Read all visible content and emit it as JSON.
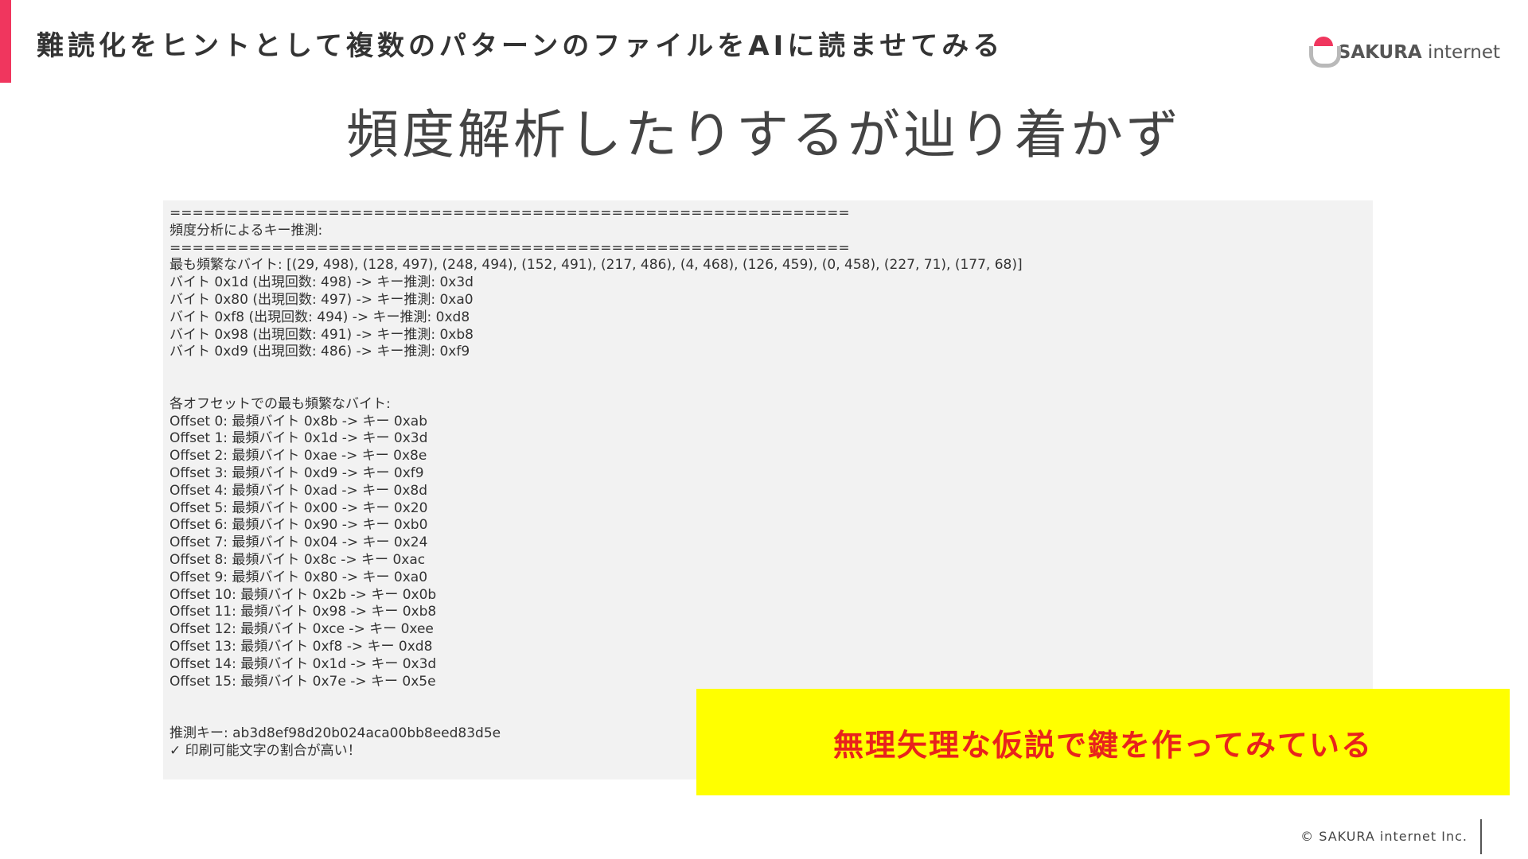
{
  "header": {
    "title": "難読化をヒントとして複数のパターンのファイルをAIに読ませてみる"
  },
  "logo": {
    "brand": "SAKURA",
    "suffix": " internet"
  },
  "slide": {
    "title": "頻度解析したりするが辿り着かず"
  },
  "console": {
    "lines": [
      "============================================================",
      "頻度分析によるキー推測:",
      "============================================================",
      "最も頻繁なバイト: [(29, 498), (128, 497), (248, 494), (152, 491), (217, 486), (4, 468), (126, 459), (0, 458), (227, 71), (177, 68)]",
      "バイト 0x1d (出現回数: 498) -> キー推測: 0x3d",
      "バイト 0x80 (出現回数: 497) -> キー推測: 0xa0",
      "バイト 0xf8 (出現回数: 494) -> キー推測: 0xd8",
      "バイト 0x98 (出現回数: 491) -> キー推測: 0xb8",
      "バイト 0xd9 (出現回数: 486) -> キー推測: 0xf9",
      "",
      "",
      "各オフセットでの最も頻繁なバイト:",
      "Offset 0: 最頻バイト 0x8b -> キー 0xab",
      "Offset 1: 最頻バイト 0x1d -> キー 0x3d",
      "Offset 2: 最頻バイト 0xae -> キー 0x8e",
      "Offset 3: 最頻バイト 0xd9 -> キー 0xf9",
      "Offset 4: 最頻バイト 0xad -> キー 0x8d",
      "Offset 5: 最頻バイト 0x00 -> キー 0x20",
      "Offset 6: 最頻バイト 0x90 -> キー 0xb0",
      "Offset 7: 最頻バイト 0x04 -> キー 0x24",
      "Offset 8: 最頻バイト 0x8c -> キー 0xac",
      "Offset 9: 最頻バイト 0x80 -> キー 0xa0",
      "Offset 10: 最頻バイト 0x2b -> キー 0x0b",
      "Offset 11: 最頻バイト 0x98 -> キー 0xb8",
      "Offset 12: 最頻バイト 0xce -> キー 0xee",
      "Offset 13: 最頻バイト 0xf8 -> キー 0xd8",
      "Offset 14: 最頻バイト 0x1d -> キー 0x3d",
      "Offset 15: 最頻バイト 0x7e -> キー 0x5e",
      "",
      "",
      "推測キー: ab3d8ef98d20b024aca00bb8eed83d5e",
      "✓ 印刷可能文字の割合が高い！"
    ]
  },
  "callout": {
    "text": "無理矢理な仮説で鍵を作ってみている"
  },
  "footer": {
    "copyright": "© SAKURA internet Inc."
  },
  "colors": {
    "accent": "#f0365e",
    "callout_bg": "#ffff00",
    "callout_text": "#e8231c",
    "console_bg": "#f2f2f2"
  }
}
